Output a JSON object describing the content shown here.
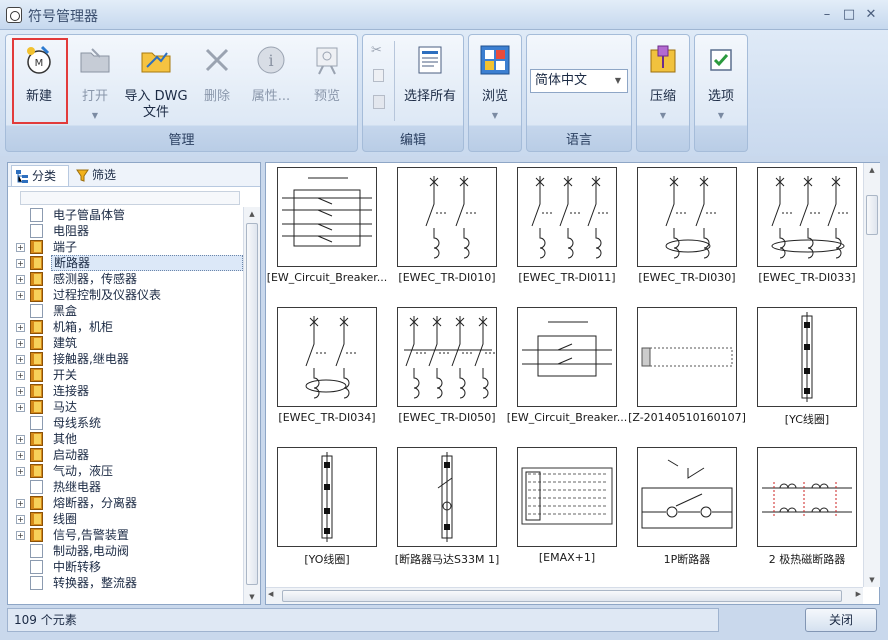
{
  "window": {
    "title": "符号管理器"
  },
  "ribbon": {
    "groups": [
      {
        "label": "管理",
        "buttons": [
          {
            "label": "新建",
            "enabled": true
          },
          {
            "label": "打开",
            "enabled": false
          },
          {
            "label": "导入 DWG\n文件",
            "enabled": true
          },
          {
            "label": "删除",
            "enabled": false
          },
          {
            "label": "属性...",
            "enabled": false
          },
          {
            "label": "预览",
            "enabled": false
          }
        ]
      },
      {
        "label": "编辑",
        "buttons": [
          {
            "label": "选择所有",
            "enabled": true
          }
        ]
      },
      {
        "label": "",
        "buttons": [
          {
            "label": "浏览",
            "enabled": true
          }
        ]
      },
      {
        "label": "语言",
        "select_value": "简体中文"
      },
      {
        "label": "",
        "buttons": [
          {
            "label": "压缩",
            "enabled": true
          }
        ]
      },
      {
        "label": "",
        "buttons": [
          {
            "label": "选项",
            "enabled": true
          }
        ]
      }
    ]
  },
  "tabs": [
    {
      "label": "分类"
    },
    {
      "label": "筛选"
    }
  ],
  "tree": {
    "items": [
      {
        "label": "电子管晶体管",
        "expandable": false
      },
      {
        "label": "电阻器",
        "expandable": false
      },
      {
        "label": "端子",
        "expandable": true
      },
      {
        "label": "断路器",
        "expandable": true,
        "selected": true
      },
      {
        "label": "感测器，传感器",
        "expandable": true
      },
      {
        "label": "过程控制及仪器仪表",
        "expandable": true
      },
      {
        "label": "黑盒",
        "expandable": false
      },
      {
        "label": "机箱，机柜",
        "expandable": true
      },
      {
        "label": "建筑",
        "expandable": true
      },
      {
        "label": "接触器,继电器",
        "expandable": true
      },
      {
        "label": "开关",
        "expandable": true
      },
      {
        "label": "连接器",
        "expandable": true
      },
      {
        "label": "马达",
        "expandable": true
      },
      {
        "label": "母线系统",
        "expandable": false
      },
      {
        "label": "其他",
        "expandable": true
      },
      {
        "label": "启动器",
        "expandable": true
      },
      {
        "label": "气动，液压",
        "expandable": true
      },
      {
        "label": "热继电器",
        "expandable": false
      },
      {
        "label": "熔断器，分离器",
        "expandable": true
      },
      {
        "label": "线圈",
        "expandable": true
      },
      {
        "label": "信号,告警装置",
        "expandable": true
      },
      {
        "label": "制动器,电动阀",
        "expandable": false
      },
      {
        "label": "中断转移",
        "expandable": false
      },
      {
        "label": "转换器，整流器",
        "expandable": false
      }
    ]
  },
  "symbols": [
    {
      "caption": "[EW_Circuit_Breaker...",
      "kind": "breaker-box"
    },
    {
      "caption": "[EWEC_TR-DI010]",
      "kind": "multi2"
    },
    {
      "caption": "[EWEC_TR-DI011]",
      "kind": "multi3"
    },
    {
      "caption": "[EWEC_TR-DI030]",
      "kind": "multi2coil"
    },
    {
      "caption": "[EWEC_TR-DI033]",
      "kind": "multi3coil"
    },
    {
      "caption": "[EWEC_TR-DI034]",
      "kind": "multi2coilb"
    },
    {
      "caption": "[EWEC_TR-DI050]",
      "kind": "multi4"
    },
    {
      "caption": "[EW_Circuit_Breaker...",
      "kind": "breaker-box2"
    },
    {
      "caption": "[Z-20140510160107]",
      "kind": "rail"
    },
    {
      "caption": "[YC线圈]",
      "kind": "vertical"
    },
    {
      "caption": "[YO线圈]",
      "kind": "vertical"
    },
    {
      "caption": "[断路器马达S33M 1]",
      "kind": "vertical2"
    },
    {
      "caption": "[EMAX+1]",
      "kind": "panel"
    },
    {
      "caption": "1P断路器",
      "kind": "onepole"
    },
    {
      "caption": "2 极热磁断路器",
      "kind": "twopole"
    }
  ],
  "status": {
    "count_text": "109 个元素"
  },
  "footer": {
    "close_label": "关闭"
  }
}
